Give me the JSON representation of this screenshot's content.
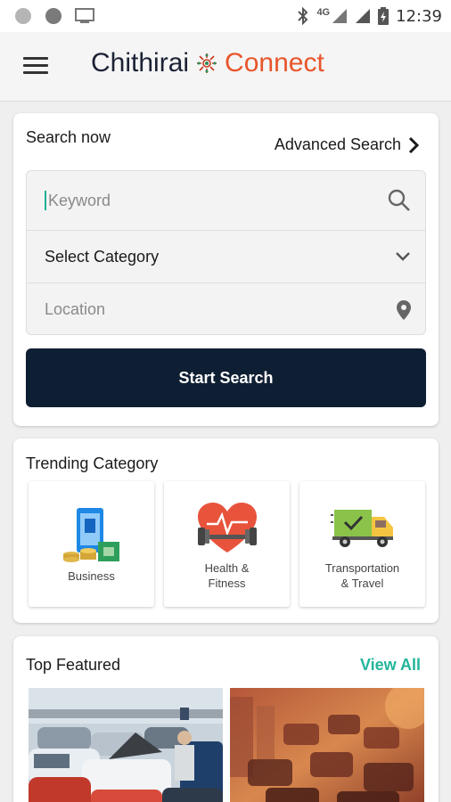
{
  "status_bar": {
    "network": "4G",
    "time": "12:39"
  },
  "app_bar": {
    "brand_first": "Chithirai",
    "brand_second": "Connect",
    "colors": {
      "brand_dark": "#1b2235",
      "brand_orange": "#e8552a"
    }
  },
  "search": {
    "title": "Search now",
    "advanced_label": "Advanced Search",
    "keyword_placeholder": "Keyword",
    "category_label": "Select Category",
    "location_label": "Location",
    "button_label": "Start Search",
    "colors": {
      "button_bg": "#0f1f33"
    }
  },
  "trending": {
    "title": "Trending Category",
    "items": [
      {
        "label": "Business",
        "icon": "business-icon"
      },
      {
        "label": "Health &\nFitness",
        "icon": "health-fitness-icon"
      },
      {
        "label": "Transportation\n& Travel",
        "icon": "truck-icon"
      }
    ]
  },
  "featured": {
    "title": "Top Featured",
    "view_all_label": "View All",
    "images": [
      "car-market-photo",
      "traffic-photo"
    ],
    "colors": {
      "accent": "#22b59a"
    }
  }
}
